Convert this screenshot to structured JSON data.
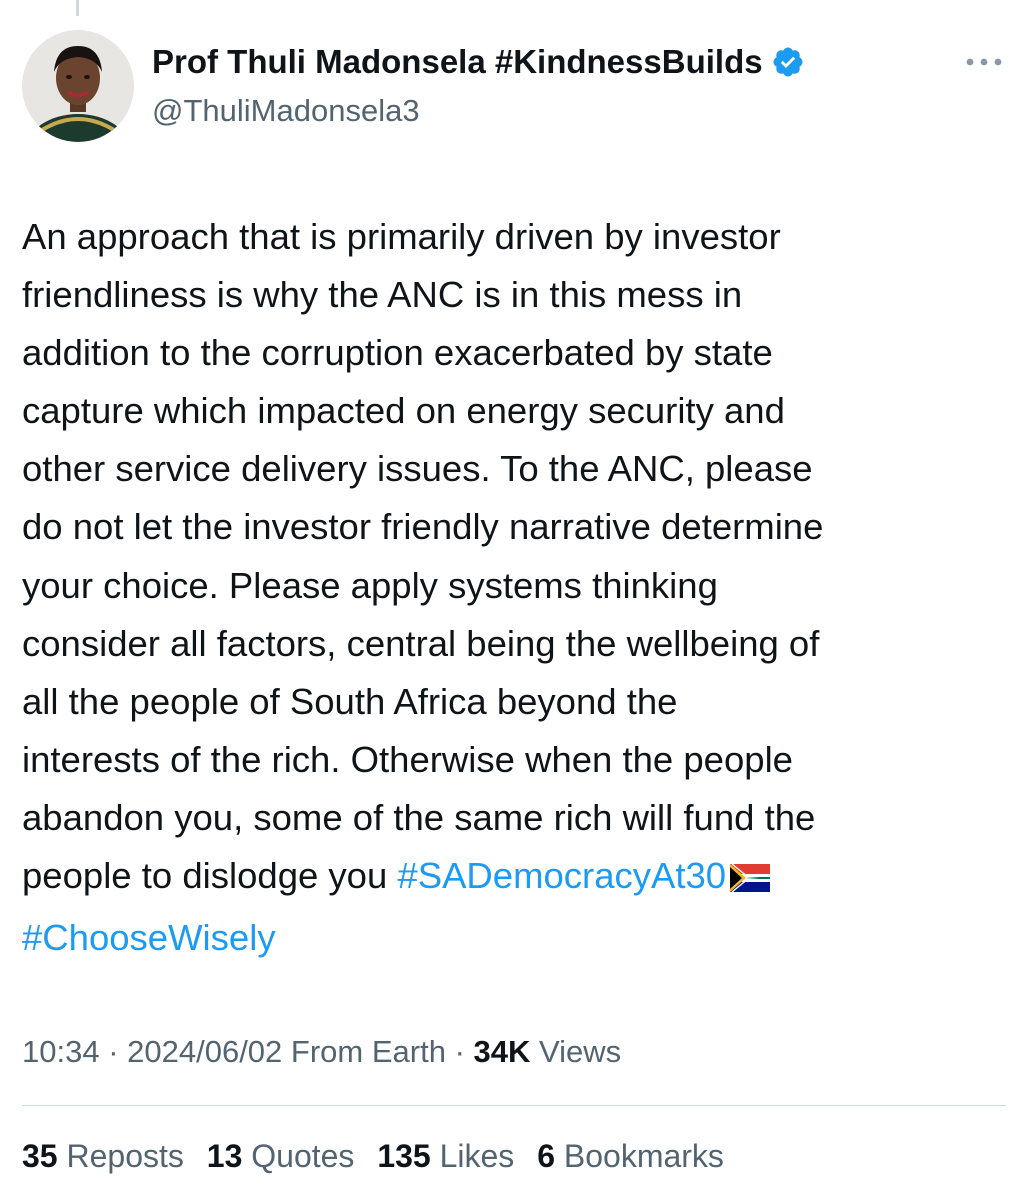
{
  "colors": {
    "link": "#1d9bf0",
    "secondary_text": "#536471",
    "primary_text": "#0f1419",
    "verified_badge": "#1d9bf0"
  },
  "author": {
    "display_name": "Prof Thuli Madonsela #KindnessBuilds",
    "handle": "@ThuliMadonsela3",
    "verified_icon": "verified-badge-icon",
    "avatar_icon": "profile-avatar"
  },
  "more_icon": "more-horizontal-icon",
  "tweet": {
    "text_line_1": "An approach that is primarily driven by investor",
    "text_line_2": "friendliness is why the ANC is in this mess in",
    "text_line_3": "addition to the corruption exacerbated by state",
    "text_line_4": "capture which impacted on energy security and",
    "text_line_5": "other service delivery issues. To the ANC, please",
    "text_line_6": "do not let the investor friendly narrative determine",
    "text_line_7": "your choice. Please apply systems thinking",
    "text_line_8": "consider all factors, central being the wellbeing of",
    "text_line_9": "all the people  of South Africa beyond the",
    "text_line_10": "interests of the rich. Otherwise when the people",
    "text_line_11": "abandon you, some of the same rich will fund the",
    "text_line_12": "people to dislodge you ",
    "hashtag_1": "#SADemocracyAt30",
    "flag_icon": "south-africa-flag-emoji",
    "hashtag_2": "#ChooseWisely"
  },
  "meta": {
    "time": "10:34",
    "separator": " · ",
    "date": "2024/06/02",
    "location": " From Earth",
    "views_count": "34K",
    "views_label": " Views"
  },
  "stats": {
    "reposts_count": "35",
    "reposts_label": "Reposts",
    "quotes_count": "13",
    "quotes_label": "Quotes",
    "likes_count": "135",
    "likes_label": "Likes",
    "bookmarks_count": "6",
    "bookmarks_label": "Bookmarks"
  }
}
